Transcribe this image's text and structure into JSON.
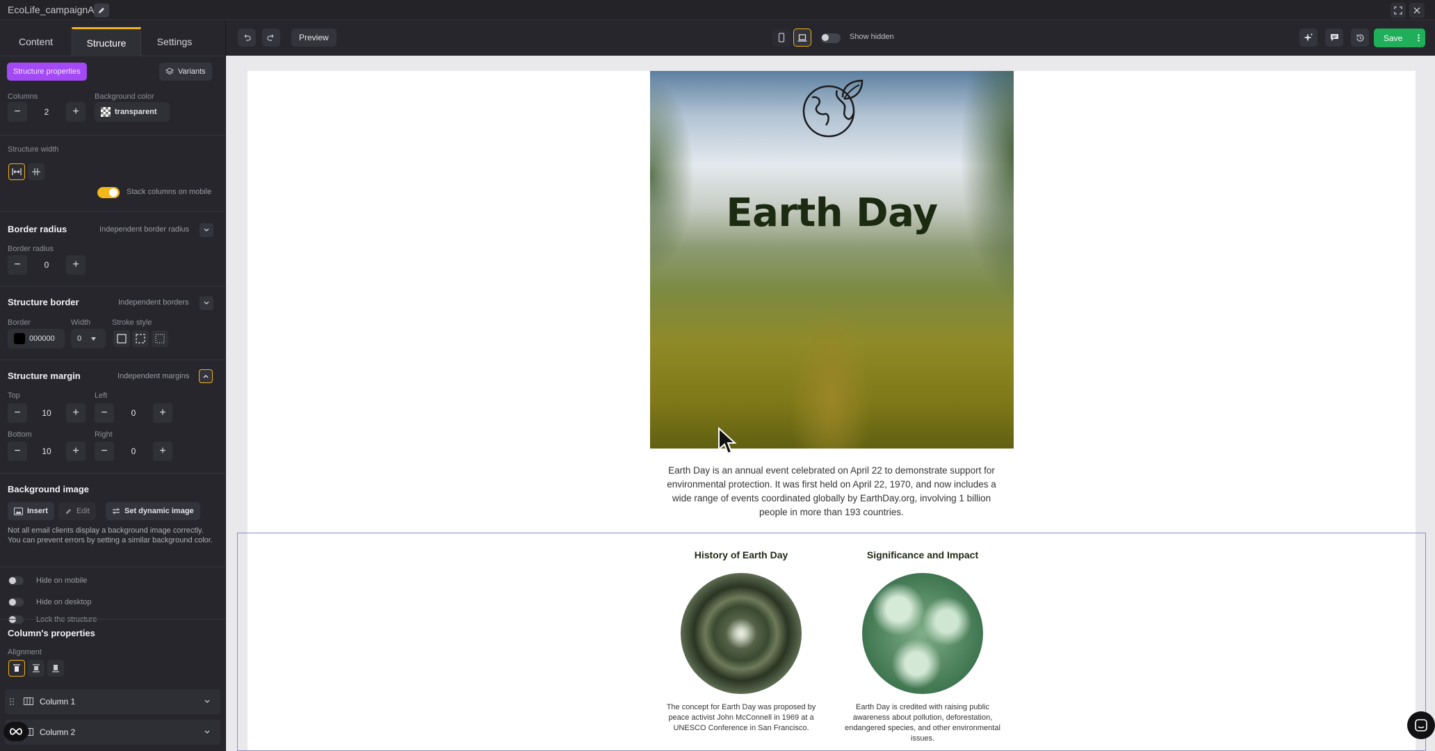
{
  "window": {
    "title": "EcoLife_campaignA"
  },
  "left_panel": {
    "tabs": [
      "Content",
      "Structure",
      "Settings"
    ],
    "structure_properties_btn": "Structure properties",
    "variants_btn": "Variants",
    "columns_label": "Columns",
    "columns_value": "2",
    "bg_color_label": "Background color",
    "bg_color_value": "transparent",
    "structure_width_label": "Structure width",
    "stack_columns_label": "Stack columns on mobile",
    "border_radius": {
      "title": "Border radius",
      "independent": "Independent border radius",
      "label": "Border radius",
      "value": "0"
    },
    "structure_border": {
      "title": "Structure border",
      "independent": "Independent borders",
      "border_label": "Border",
      "width_label": "Width",
      "stroke_label": "Stroke style",
      "color_value": "000000",
      "width_value": "0"
    },
    "structure_margin": {
      "title": "Structure margin",
      "independent": "Independent margins",
      "top_label": "Top",
      "left_label": "Left",
      "bottom_label": "Bottom",
      "right_label": "Right",
      "top": "10",
      "left": "0",
      "bottom": "10",
      "right": "0"
    },
    "background_image": {
      "title": "Background image",
      "insert": "Insert",
      "edit": "Edit",
      "dynamic": "Set dynamic image",
      "note": "Not all email clients display a background image correctly. You can prevent errors by setting a similar background color."
    },
    "toggles": [
      "Hide on mobile",
      "Hide on desktop",
      "Lock the structure"
    ],
    "columns_props": {
      "title": "Column's properties",
      "alignment_label": "Alignment",
      "column1": "Column 1",
      "column2": "Column 2"
    }
  },
  "toolbar": {
    "preview": "Preview",
    "show_hidden": "Show hidden",
    "save": "Save"
  },
  "email": {
    "hero_title": "Earth Day",
    "intro": "Earth Day is an annual event celebrated on April 22 to demonstrate support for environmental protection. It was first held on April 22, 1970, and now includes a wide range of events coordinated globally by EarthDay.org, involving 1 billion people in more than 193 countries.",
    "col1_title": "History of Earth Day",
    "col1_text": "The concept for Earth Day was proposed by peace activist John McConnell in 1969 at a UNESCO Conference in San Francisco.",
    "col2_title": "Significance and Impact",
    "col2_text": "Earth Day is credited with raising public awareness about pollution, deforestation, endangered species, and other environmental issues."
  },
  "colors": {
    "accent": "#f0b415",
    "highlight": "#a349f5",
    "save": "#1fae59",
    "panel": "#26262c"
  }
}
